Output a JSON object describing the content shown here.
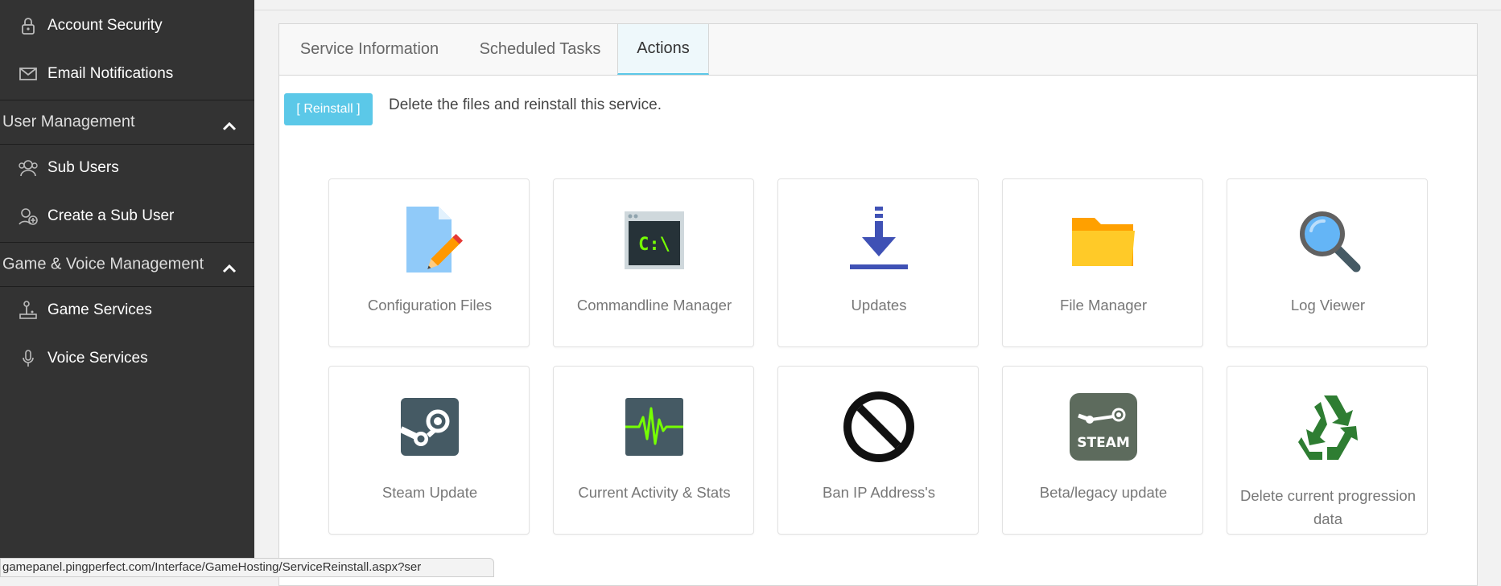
{
  "sidebar": {
    "items_top": [
      {
        "label": "Account Security",
        "icon": "lock-icon"
      },
      {
        "label": "Email Notifications",
        "icon": "envelope-icon"
      }
    ],
    "user_management": {
      "label": "User Management",
      "items": [
        {
          "label": "Sub Users",
          "icon": "users-icon"
        },
        {
          "label": "Create a Sub User",
          "icon": "add-user-icon"
        }
      ]
    },
    "game_voice": {
      "label": "Game & Voice Management",
      "items": [
        {
          "label": "Game Services",
          "icon": "joystick-icon"
        },
        {
          "label": "Voice Services",
          "icon": "microphone-icon"
        }
      ]
    }
  },
  "tabs": [
    {
      "label": "Service Information",
      "active": false
    },
    {
      "label": "Scheduled Tasks",
      "active": false
    },
    {
      "label": "Actions",
      "active": true
    }
  ],
  "reinstall": {
    "button_label": "[ Reinstall ]",
    "description": "Delete the files and reinstall this service."
  },
  "actions": [
    {
      "label": "Configuration Files",
      "icon": "config-file-icon"
    },
    {
      "label": "Commandline Manager",
      "icon": "terminal-icon"
    },
    {
      "label": "Updates",
      "icon": "download-icon"
    },
    {
      "label": "File Manager",
      "icon": "folder-icon"
    },
    {
      "label": "Log Viewer",
      "icon": "magnifier-icon"
    },
    {
      "label": "Steam Update",
      "icon": "steam-icon"
    },
    {
      "label": "Current Activity & Stats",
      "icon": "activity-monitor-icon"
    },
    {
      "label": "Ban IP Address's",
      "icon": "ban-icon"
    },
    {
      "label": "Beta/legacy update",
      "icon": "steam-logo-icon"
    },
    {
      "label": "Delete current progression data",
      "icon": "recycle-icon"
    }
  ],
  "status_url": "gamepanel.pingperfect.com/Interface/GameHosting/ServiceReinstall.aspx?ser",
  "colors": {
    "sidebar_bg": "#333333",
    "accent": "#5bc8e8",
    "card_border": "#e2e2e2"
  }
}
